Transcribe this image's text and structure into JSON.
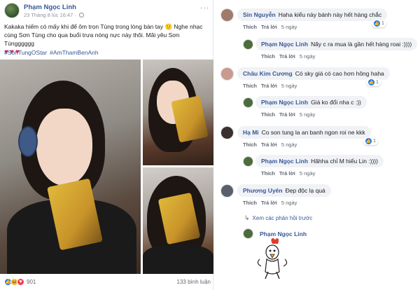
{
  "post": {
    "author": "Phạm Ngọc Linh",
    "timestamp": "23 Tháng 8 lúc 16:47",
    "menu": "···",
    "text": "Kakaka hiếm có mấy khi để ôm trọn Tùng trong lòng bàn tay 🙂 Nghe nhạc cùng Sơn Tùng cho qua buổi trưa nóng nực này thôi. Mãi yêu Sơn Tùngggggg",
    "hearts": "♥♥♥",
    "hashtags": [
      "#SonTungOStar",
      "#AmThamBenAnh"
    ],
    "reaction_count": "901",
    "comment_count": "133 bình luận"
  },
  "comments": [
    {
      "name": "Sin Nguyễn",
      "text": "Haha kiểu này bánh này hết hàng chắc",
      "like": "Thích",
      "reply": "Trả lời",
      "time": "5 ngày",
      "likes": "1",
      "avatar_color": "#a07a6a"
    },
    {
      "name": "Phạm Ngọc Linh",
      "text": "Nãy c ra mua là gần hết hàng roai :))))",
      "like": "Thích",
      "reply": "Trả lời",
      "time": "5 ngày",
      "likes": "",
      "avatar_color": "#4d6b3c"
    },
    {
      "name": "Châu Kim Cương",
      "text": "Có sky giá có cao hơn hông haha",
      "like": "Thích",
      "reply": "Trả lời",
      "time": "5 ngày",
      "likes": "1",
      "avatar_color": "#c99a8f"
    },
    {
      "name": "Phạm Ngọc Linh",
      "text": "Giá ko đổi nha c :))",
      "like": "Thích",
      "reply": "Trả lời",
      "time": "5 ngày",
      "likes": "",
      "avatar_color": "#4d6b3c"
    },
    {
      "name": "Hạ Mi",
      "text": "Co son tung la an banh ngon roi ne kkk",
      "like": "Thích",
      "reply": "Trả lời",
      "time": "5 ngày",
      "likes": "1",
      "avatar_color": "#3b2f2f"
    },
    {
      "name": "Phạm Ngọc Linh",
      "text": "Hâhha chỉ M hiểu Lin :))))",
      "like": "Thích",
      "reply": "Trả lời",
      "time": "5 ngày",
      "likes": "",
      "avatar_color": "#4d6b3c"
    },
    {
      "name": "Phương Uyên",
      "text": "Đẹp độc lạ quá",
      "like": "Thích",
      "reply": "Trả lời",
      "time": "5 ngày",
      "likes": "",
      "avatar_color": "#5a5f6b"
    }
  ],
  "view_previous": "Xem các phản hồi trước",
  "last_reply": {
    "name": "Phạm Ngọc Linh",
    "avatar_color": "#4d6b3c"
  },
  "colors": {
    "link": "#385898",
    "bubble": "#f0f2f5",
    "like_blue": "#1877f2"
  }
}
